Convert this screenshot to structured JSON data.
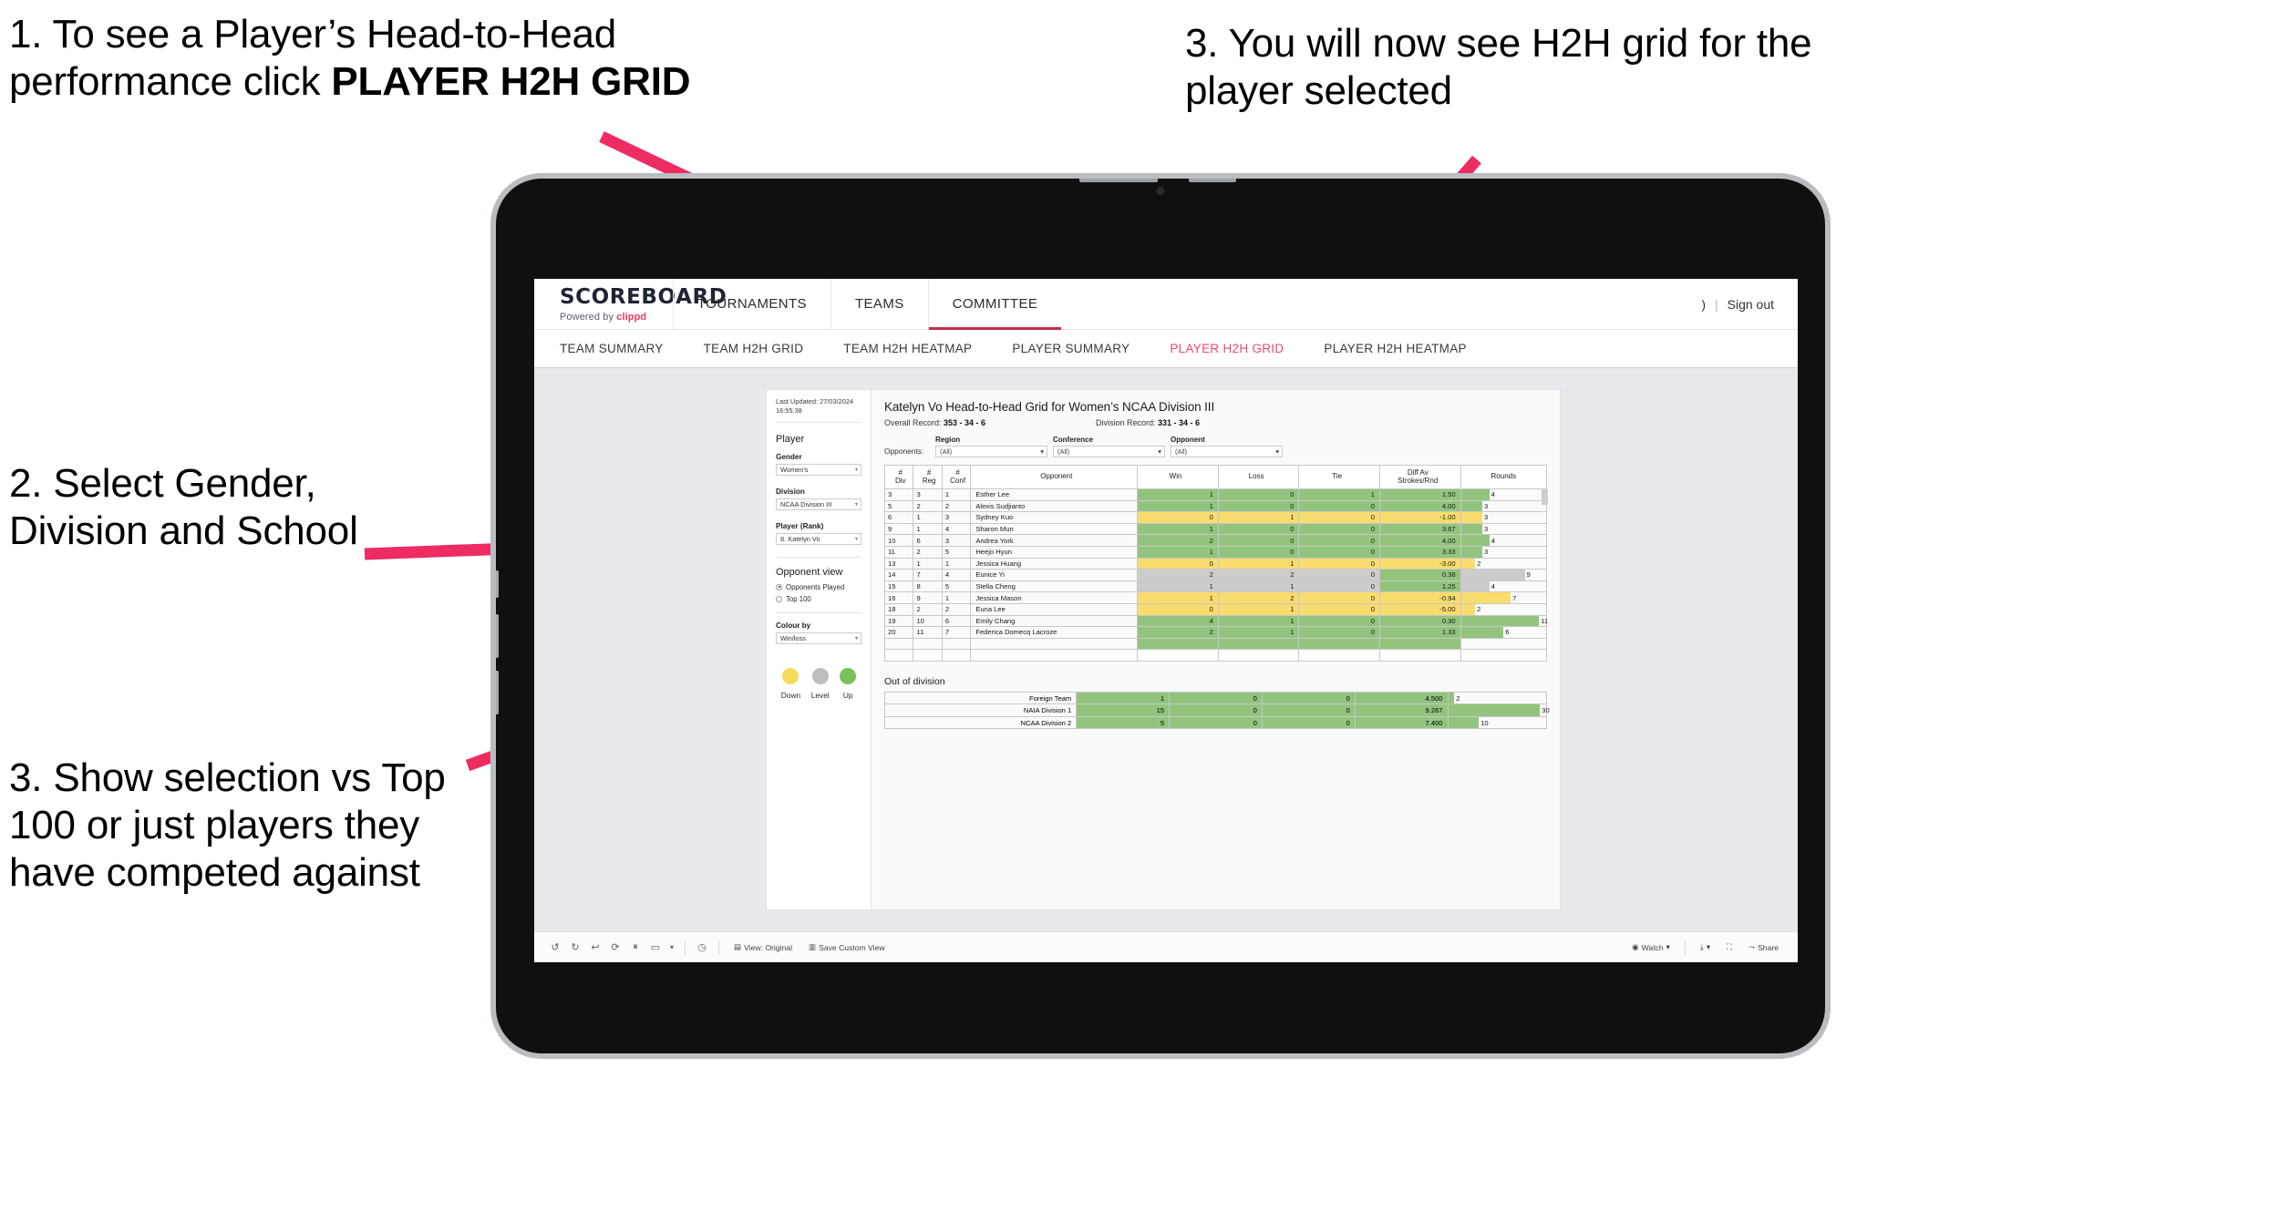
{
  "annotations": [
    {
      "id": "anno-1",
      "pre": "1. To see a Player’s Head-to-Head performance click ",
      "bold": "PLAYER H2H GRID"
    },
    {
      "id": "anno-2",
      "text": "2. Select Gender, Division and School"
    },
    {
      "id": "anno-3",
      "text": "3. Show selection vs Top 100 or just players they have competed against"
    },
    {
      "id": "anno-4",
      "text": "3. You will now see H2H grid for the player selected"
    }
  ],
  "brand": {
    "title": "SCOREBOARD",
    "powered_prefix": "Powered by ",
    "powered_accent": "clippd"
  },
  "topnav": {
    "items": [
      {
        "label": "TOURNAMENTS"
      },
      {
        "label": "TEAMS"
      },
      {
        "label": "COMMITTEE"
      }
    ],
    "user_glyph": ")",
    "separator": "|",
    "sign_out": "Sign out"
  },
  "subnav": {
    "items": [
      {
        "label": "TEAM SUMMARY",
        "active": false
      },
      {
        "label": "TEAM H2H GRID",
        "active": false
      },
      {
        "label": "TEAM H2H HEATMAP",
        "active": false
      },
      {
        "label": "PLAYER SUMMARY",
        "active": false
      },
      {
        "label": "PLAYER H2H GRID",
        "active": true
      },
      {
        "label": "PLAYER H2H HEATMAP",
        "active": false
      }
    ]
  },
  "filters": {
    "last_updated": "Last Updated: 27/03/2024 16:55:38",
    "player_heading": "Player",
    "gender_label": "Gender",
    "gender_value": "Women’s",
    "division_label": "Division",
    "division_value": "NCAA Division III",
    "player_rank_label": "Player (Rank)",
    "player_rank_value": "8. Katelyn Vo",
    "opponent_view_heading": "Opponent view",
    "opponent_view_options": [
      {
        "label": "Opponents Played",
        "selected": true
      },
      {
        "label": "Top 100",
        "selected": false
      }
    ],
    "colour_by_label": "Colour by",
    "colour_by_value": "Win/loss",
    "legend": [
      {
        "label": "Down",
        "color": "#f2dd5d"
      },
      {
        "label": "Level",
        "color": "#bdbdbd"
      },
      {
        "label": "Up",
        "color": "#78c25a"
      }
    ]
  },
  "sheet": {
    "title": "Katelyn Vo Head-to-Head Grid for Women’s NCAA Division III",
    "overall_record_label": "Overall Record: ",
    "overall_record_value": "353 -  34 - 6",
    "division_record_label": "Division Record: ",
    "division_record_value": "331 -  34 - 6",
    "opponents_label": "Opponents:",
    "opponent_filters": [
      {
        "label": "Region",
        "value": "(All)"
      },
      {
        "label": "Conference",
        "value": "(All)"
      },
      {
        "label": "Opponent",
        "value": "(All)"
      }
    ]
  },
  "chart_data": {
    "type": "table",
    "title": "Katelyn Vo Head-to-Head Grid for Women’s NCAA Division III",
    "columns": [
      "# Div",
      "# Reg",
      "# Conf",
      "Opponent",
      "Win",
      "Loss",
      "Tie",
      "Diff Av Strokes/Rnd",
      "Rounds"
    ],
    "column_headers_two_line": [
      [
        "#",
        "Div"
      ],
      [
        "#",
        "Reg"
      ],
      [
        "#",
        "Conf"
      ],
      [
        "",
        "Opponent"
      ],
      [
        "",
        "Win"
      ],
      [
        "",
        "Loss"
      ],
      [
        "",
        "Tie"
      ],
      [
        "Diff Av",
        "Strokes/Rnd"
      ],
      [
        "",
        "Rounds"
      ]
    ],
    "rounds_axis_max": 12,
    "rows": [
      {
        "div": "3",
        "reg": "3",
        "conf": "1",
        "opponent": "Esther Lee",
        "win": "1",
        "loss": "0",
        "tie": "1",
        "diff": "1.50",
        "rounds": 4,
        "color": "#92c47d"
      },
      {
        "div": "5",
        "reg": "2",
        "conf": "2",
        "opponent": "Alexis Sudjianto",
        "win": "1",
        "loss": "0",
        "tie": "0",
        "diff": "4.00",
        "rounds": 3,
        "color": "#92c47d"
      },
      {
        "div": "6",
        "reg": "1",
        "conf": "3",
        "opponent": "Sydney Kuo",
        "win": "0",
        "loss": "1",
        "tie": "0",
        "diff": "-1.00",
        "rounds": 3,
        "color": "#f8dc6e"
      },
      {
        "div": "9",
        "reg": "1",
        "conf": "4",
        "opponent": "Sharon Mun",
        "win": "1",
        "loss": "0",
        "tie": "0",
        "diff": "3.67",
        "rounds": 3,
        "color": "#92c47d"
      },
      {
        "div": "10",
        "reg": "6",
        "conf": "3",
        "opponent": "Andrea York",
        "win": "2",
        "loss": "0",
        "tie": "0",
        "diff": "4.00",
        "rounds": 4,
        "color": "#92c47d"
      },
      {
        "div": "11",
        "reg": "2",
        "conf": "5",
        "opponent": "Heejo Hyun",
        "win": "1",
        "loss": "0",
        "tie": "0",
        "diff": "3.33",
        "rounds": 3,
        "color": "#92c47d"
      },
      {
        "div": "13",
        "reg": "1",
        "conf": "1",
        "opponent": "Jessica Huang",
        "win": "0",
        "loss": "1",
        "tie": "0",
        "diff": "-3.00",
        "rounds": 2,
        "color": "#f8dc6e"
      },
      {
        "div": "14",
        "reg": "7",
        "conf": "4",
        "opponent": "Eunice Yi",
        "win": "2",
        "loss": "2",
        "tie": "0",
        "diff": "0.38",
        "rounds": 9,
        "color": "#cccccc",
        "diff_color": "#92c47d"
      },
      {
        "div": "15",
        "reg": "8",
        "conf": "5",
        "opponent": "Stella Cheng",
        "win": "1",
        "loss": "1",
        "tie": "0",
        "diff": "1.25",
        "rounds": 4,
        "color": "#cccccc",
        "diff_color": "#92c47d"
      },
      {
        "div": "16",
        "reg": "9",
        "conf": "1",
        "opponent": "Jessica Mason",
        "win": "1",
        "loss": "2",
        "tie": "0",
        "diff": "-0.94",
        "rounds": 7,
        "color": "#f8dc6e"
      },
      {
        "div": "18",
        "reg": "2",
        "conf": "2",
        "opponent": "Euna Lee",
        "win": "0",
        "loss": "1",
        "tie": "0",
        "diff": "-5.00",
        "rounds": 2,
        "color": "#f8dc6e"
      },
      {
        "div": "19",
        "reg": "10",
        "conf": "6",
        "opponent": "Emily Chang",
        "win": "4",
        "loss": "1",
        "tie": "0",
        "diff": "0.30",
        "rounds": 11,
        "color": "#92c47d"
      },
      {
        "div": "20",
        "reg": "11",
        "conf": "7",
        "opponent": "Federica Domecq Lacroze",
        "win": "2",
        "loss": "1",
        "tie": "0",
        "diff": "1.33",
        "rounds": 6,
        "color": "#92c47d"
      }
    ],
    "out_of_division_title": "Out of division",
    "out_of_division_rounds_max": 32,
    "out_of_division": [
      {
        "name": "Foreign Team",
        "win": "1",
        "loss": "0",
        "tie": "0",
        "diff": "4.500",
        "rounds": 2,
        "color": "#92c47d"
      },
      {
        "name": "NAIA Division 1",
        "win": "15",
        "loss": "0",
        "tie": "0",
        "diff": "9.267",
        "rounds": 30,
        "color": "#92c47d"
      },
      {
        "name": "NCAA Division 2",
        "win": "5",
        "loss": "0",
        "tie": "0",
        "diff": "7.400",
        "rounds": 10,
        "color": "#92c47d"
      }
    ]
  },
  "toolbar": {
    "view_label": "View: Original",
    "save_label": "Save Custom View",
    "watch_label": "Watch",
    "share_label": "Share"
  }
}
